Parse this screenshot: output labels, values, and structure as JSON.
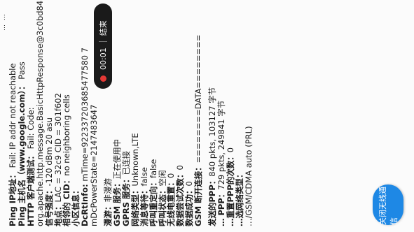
{
  "status_bar": {
    "text1": "…",
    "text2": "…"
  },
  "recording": {
    "time": "00:01",
    "end_label": "结束"
  },
  "info": {
    "ping_ip": {
      "label": "Ping IP地址：",
      "value": "Fail: IP addr not reachable"
    },
    "ping_host": {
      "label": "Ping 主机名（www.google.com）：",
      "value": "Pass"
    },
    "http_test": {
      "label": "HTTP 客户端测试：",
      "value": "Fail: Code: org.apache.http.message.BasicHttpResponse@3c0bd84"
    },
    "signal": {
      "label": "信号强度：",
      "value": "-120 dBm  20 asu"
    },
    "location": {
      "label": "地点：",
      "value": "LAC = 32c9  CID = 301f602"
    },
    "neighbor": {
      "label": "相邻的 CID：",
      "value": "no neighboring cells"
    },
    "cell_info": {
      "label": "小区信息：",
      "value": ""
    },
    "dcrt_info": {
      "label": "DcRtInfo:",
      "value": "mTime=922337203685477580 7 mDcPowerState=2147483647"
    },
    "roaming": {
      "label": "漫游：",
      "value": "非漫游"
    },
    "gsm_service": {
      "label": "GSM 服务：",
      "value": "正在使用中"
    },
    "gprs_service": {
      "label": "GPRS 服务：",
      "value": "已连接"
    },
    "network_type": {
      "label": "网络类型：",
      "value": "Unknown,LTE"
    },
    "msg_waiting": {
      "label": "消息等待：",
      "value": "false"
    },
    "call_redirect": {
      "label": "呼叫重定向：",
      "value": "false"
    },
    "call_status": {
      "label": "呼叫状态：",
      "value": "空闲"
    },
    "radio_reset": {
      "label": "无线电重置：",
      "value": "0"
    },
    "data_attempts": {
      "label": "数据尝试次数：",
      "value": "0"
    },
    "data_success": {
      "label": "数据成功：",
      "value": "0"
    },
    "gsm_disconnect": {
      "label": "GSM 断开连接：",
      "value": "========DATA========"
    },
    "ppp_sent": {
      "label": "发送的PPP：",
      "value": "840 pkts, 103127 字节"
    },
    "ppp_recv": {
      "label": "… PPP：",
      "value": "729 pkts, 249841 字节"
    },
    "ppp_reset": {
      "label": "…重置PPP的次数：",
      "value": "0"
    },
    "pref_network": {
      "label": "…选网络类型：",
      "value": ""
    },
    "pref_network_value": {
      "value": "…/GSM/CDMA auto (PRL)"
    }
  },
  "blue_button": {
    "label": "关闭无线通信"
  }
}
